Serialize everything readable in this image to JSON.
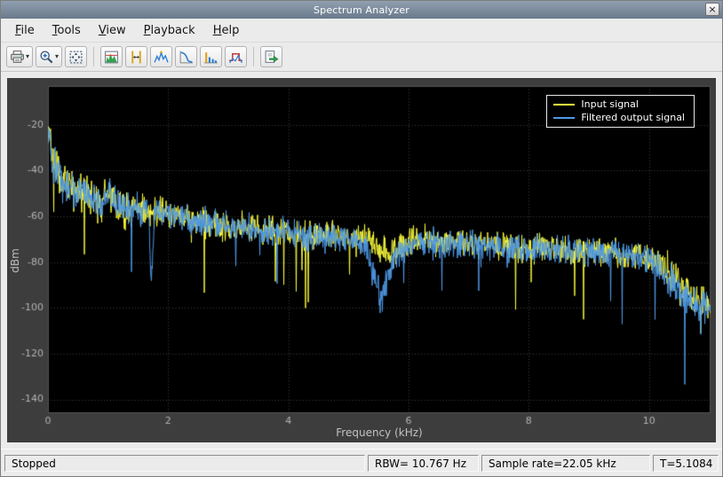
{
  "window": {
    "title": "Spectrum Analyzer",
    "close_glyph": "×"
  },
  "menu": {
    "items": [
      {
        "label": "File"
      },
      {
        "label": "Tools"
      },
      {
        "label": "View"
      },
      {
        "label": "Playback"
      },
      {
        "label": "Help"
      }
    ]
  },
  "toolbar": {
    "caret": "▾",
    "buttons": [
      {
        "name": "print-button",
        "icon": "printer-icon",
        "dropdown": true
      },
      {
        "name": "zoom-button",
        "icon": "zoom-in-icon",
        "dropdown": true
      },
      {
        "name": "scale-axes-button",
        "icon": "fit-to-view-icon"
      },
      {
        "separator": true
      },
      {
        "name": "spectrum-settings-button",
        "icon": "spectrum-settings-icon"
      },
      {
        "name": "cursor-measurements-button",
        "icon": "cursor-measurements-icon"
      },
      {
        "name": "peak-finder-button",
        "icon": "peak-finder-icon"
      },
      {
        "name": "ccdf-measurements-button",
        "icon": "ccdf-icon"
      },
      {
        "name": "distortion-measurements-button",
        "icon": "distortion-icon"
      },
      {
        "name": "spectral-mask-button",
        "icon": "spectral-mask-icon"
      },
      {
        "separator": true
      },
      {
        "name": "step-forward-button",
        "icon": "step-forward-icon"
      }
    ]
  },
  "status_bar": {
    "state": "Stopped",
    "rbw": "RBW= 10.767 Hz",
    "sample_rate": "Sample rate=22.05 kHz",
    "time": "T=5.1084"
  },
  "chart_data": {
    "type": "line",
    "title": "",
    "xlabel": "Frequency (kHz)",
    "ylabel": "dBm",
    "xlim": [
      0,
      11.025
    ],
    "ylim": [
      -146,
      -3
    ],
    "xticks": [
      0,
      2,
      4,
      6,
      8,
      10
    ],
    "yticks": [
      -20,
      -40,
      -60,
      -80,
      -100,
      -120,
      -140
    ],
    "grid": true,
    "background": "#000000",
    "grid_color": "#424242",
    "tick_color": "#b2b2b2",
    "legend_position": "top-right",
    "series": [
      {
        "name": "Input signal",
        "color": "#fafa3c",
        "envelope": [
          [
            0,
            -21
          ],
          [
            0.04,
            -27
          ],
          [
            0.08,
            -38
          ],
          [
            0.15,
            -37
          ],
          [
            0.22,
            -45
          ],
          [
            0.3,
            -47
          ],
          [
            0.4,
            -46
          ],
          [
            0.5,
            -51
          ],
          [
            0.62,
            -49
          ],
          [
            0.75,
            -52
          ],
          [
            0.9,
            -54
          ],
          [
            1.0,
            -50
          ],
          [
            1.15,
            -56
          ],
          [
            1.3,
            -57
          ],
          [
            1.5,
            -56
          ],
          [
            1.72,
            -58
          ],
          [
            2.0,
            -58
          ],
          [
            2.2,
            -60
          ],
          [
            2.5,
            -62
          ],
          [
            2.8,
            -63
          ],
          [
            3.0,
            -65
          ],
          [
            3.3,
            -64
          ],
          [
            3.6,
            -66
          ],
          [
            3.9,
            -66
          ],
          [
            4.2,
            -68
          ],
          [
            4.5,
            -69
          ],
          [
            4.8,
            -68
          ],
          [
            5.1,
            -68
          ],
          [
            5.3,
            -70
          ],
          [
            5.5,
            -74
          ],
          [
            5.7,
            -77
          ],
          [
            5.9,
            -73
          ],
          [
            6.1,
            -70
          ],
          [
            6.4,
            -71
          ],
          [
            6.7,
            -72
          ],
          [
            7.0,
            -72
          ],
          [
            7.4,
            -73
          ],
          [
            7.8,
            -74
          ],
          [
            8.2,
            -74
          ],
          [
            8.6,
            -75
          ],
          [
            9.0,
            -75
          ],
          [
            9.4,
            -76
          ],
          [
            9.8,
            -77
          ],
          [
            10.1,
            -79
          ],
          [
            10.3,
            -84
          ],
          [
            10.5,
            -90
          ],
          [
            10.7,
            -95
          ],
          [
            10.9,
            -98
          ],
          [
            11.025,
            -99
          ]
        ]
      },
      {
        "name": "Filtered output signal",
        "color": "#4f9ae8",
        "envelope": [
          [
            0,
            -21
          ],
          [
            0.04,
            -27
          ],
          [
            0.08,
            -38
          ],
          [
            0.15,
            -37
          ],
          [
            0.22,
            -45
          ],
          [
            0.3,
            -47
          ],
          [
            0.4,
            -46
          ],
          [
            0.5,
            -51
          ],
          [
            0.62,
            -49
          ],
          [
            0.75,
            -52
          ],
          [
            0.9,
            -54
          ],
          [
            1.0,
            -50
          ],
          [
            1.15,
            -56
          ],
          [
            1.3,
            -57
          ],
          [
            1.5,
            -56
          ],
          [
            1.68,
            -59
          ],
          [
            1.72,
            -90
          ],
          [
            1.78,
            -59
          ],
          [
            2.0,
            -58
          ],
          [
            2.2,
            -60
          ],
          [
            2.5,
            -62
          ],
          [
            2.8,
            -63
          ],
          [
            3.0,
            -65
          ],
          [
            3.3,
            -64
          ],
          [
            3.6,
            -66
          ],
          [
            3.9,
            -66
          ],
          [
            4.2,
            -68
          ],
          [
            4.5,
            -69
          ],
          [
            4.8,
            -69
          ],
          [
            5.1,
            -70
          ],
          [
            5.3,
            -75
          ],
          [
            5.45,
            -88
          ],
          [
            5.55,
            -97
          ],
          [
            5.65,
            -86
          ],
          [
            5.8,
            -77
          ],
          [
            5.95,
            -73
          ],
          [
            6.1,
            -70
          ],
          [
            6.4,
            -71
          ],
          [
            6.7,
            -72
          ],
          [
            7.0,
            -72
          ],
          [
            7.4,
            -73
          ],
          [
            7.8,
            -74
          ],
          [
            8.2,
            -74
          ],
          [
            8.6,
            -75
          ],
          [
            9.0,
            -75
          ],
          [
            9.4,
            -76
          ],
          [
            9.8,
            -77
          ],
          [
            10.1,
            -80
          ],
          [
            10.3,
            -86
          ],
          [
            10.5,
            -92
          ],
          [
            10.7,
            -97
          ],
          [
            10.9,
            -100
          ],
          [
            11.025,
            -101
          ]
        ]
      }
    ]
  }
}
